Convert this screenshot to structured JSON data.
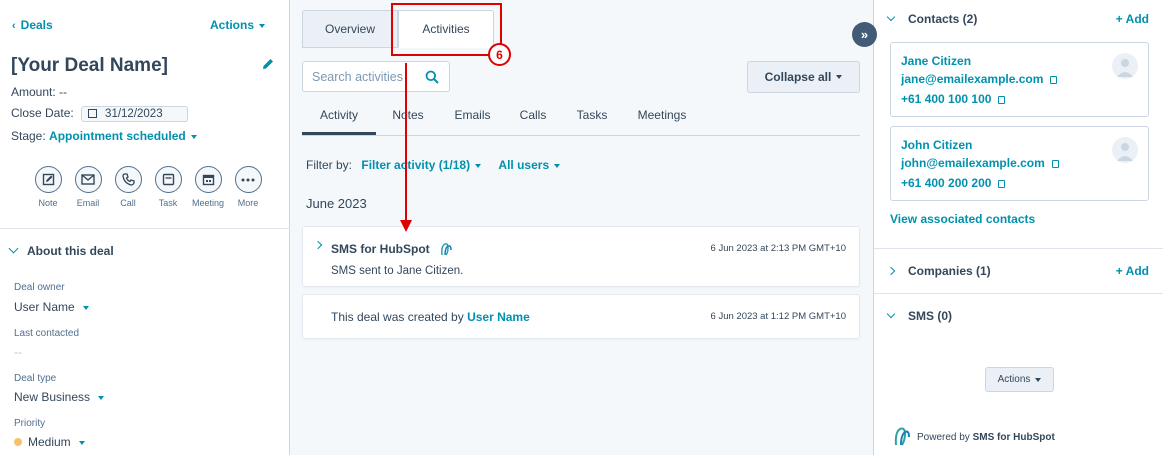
{
  "left": {
    "breadcrumb": "Deals",
    "actions_label": "Actions",
    "deal_name": "[Your Deal Name]",
    "amount_label": "Amount:",
    "amount_value": "--",
    "close_date_label": "Close Date:",
    "close_date_value": "31/12/2023",
    "stage_label": "Stage:",
    "stage_value": "Appointment scheduled",
    "activity_buttons": [
      {
        "label": "Note",
        "icon": "note-icon"
      },
      {
        "label": "Email",
        "icon": "email-icon"
      },
      {
        "label": "Call",
        "icon": "call-icon"
      },
      {
        "label": "Task",
        "icon": "task-icon"
      },
      {
        "label": "Meeting",
        "icon": "meeting-icon"
      },
      {
        "label": "More",
        "icon": "more-icon"
      }
    ],
    "about_title": "About this deal",
    "fields": [
      {
        "label": "Deal owner",
        "value": "User Name",
        "dropdown": true
      },
      {
        "label": "Last contacted",
        "value": "--",
        "dropdown": false
      },
      {
        "label": "Deal type",
        "value": "New Business",
        "dropdown": true
      },
      {
        "label": "Priority",
        "value": "Medium",
        "dropdown": true
      }
    ],
    "priority_color": "#f5c26b"
  },
  "middle": {
    "tabs": [
      "Overview",
      "Activities"
    ],
    "active_tab": "Activities",
    "search_placeholder": "Search activities",
    "collapse_label": "Collapse all",
    "subtabs": [
      "Activity",
      "Notes",
      "Emails",
      "Calls",
      "Tasks",
      "Meetings"
    ],
    "active_subtab": "Activity",
    "filter_by_label": "Filter by:",
    "filter_activity": "Filter activity (1/18)",
    "all_users": "All users",
    "month": "June 2023",
    "cards": [
      {
        "title": "SMS for HubSpot",
        "body": "SMS sent to Jane Citizen.",
        "time": "6 Jun 2023 at 2:13 PM GMT+10"
      },
      {
        "body_prefix": "This deal was created by",
        "body_link": "User Name",
        "time": "6 Jun 2023 at 1:12 PM GMT+10"
      }
    ],
    "annotation_number": "6"
  },
  "right": {
    "contacts_title": "Contacts (2)",
    "add_label": "+ Add",
    "contacts": [
      {
        "name": "Jane Citizen",
        "email": "jane@emailexample.com",
        "phone": "+61 400 100 100"
      },
      {
        "name": "John Citizen",
        "email": "john@emailexample.com",
        "phone": "+61 400 200 200"
      }
    ],
    "view_associated": "View associated contacts",
    "companies_title": "Companies (1)",
    "sms_title": "SMS (0)",
    "actions_label": "Actions",
    "powered_prefix": "Powered by",
    "powered_brand": "SMS for HubSpot"
  },
  "colors": {
    "accent": "#0091ae",
    "annotation": "#e00000",
    "text": "#33475b"
  }
}
